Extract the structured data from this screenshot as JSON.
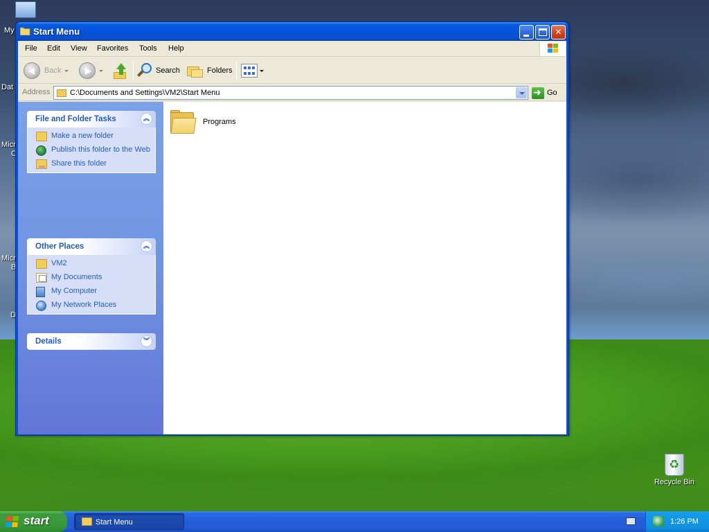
{
  "desktop": {
    "partial_labels": [
      "My",
      "Dat",
      "Micr",
      "C",
      "Micr",
      "B",
      "D"
    ],
    "recycle_bin_label": "Recycle Bin"
  },
  "window": {
    "title": "Start Menu",
    "menu": [
      "File",
      "Edit",
      "View",
      "Favorites",
      "Tools",
      "Help"
    ],
    "toolbar": {
      "back_label": "Back",
      "search_label": "Search",
      "folders_label": "Folders"
    },
    "address": {
      "label": "Address",
      "value": "C:\\Documents and Settings\\VM2\\Start Menu",
      "go_label": "Go"
    },
    "task_pane": {
      "file_tasks": {
        "title": "File and Folder Tasks",
        "items": [
          "Make a new folder",
          "Publish this folder to the Web",
          "Share this folder"
        ]
      },
      "other_places": {
        "title": "Other Places",
        "items": [
          "VM2",
          "My Documents",
          "My Computer",
          "My Network Places"
        ]
      },
      "details": {
        "title": "Details"
      }
    },
    "content": {
      "items": [
        {
          "name": "Programs",
          "icon": "folder-icon"
        }
      ]
    }
  },
  "taskbar": {
    "start_label": "start",
    "tasks": [
      "Start Menu"
    ],
    "clock": "1:26 PM"
  },
  "colors": {
    "titlebar": "#0454dd",
    "task_link": "#215dc6",
    "taskpane_bg": "#6f94e2",
    "start_green": "#3a9a3a",
    "taskbar_blue": "#245edb"
  }
}
